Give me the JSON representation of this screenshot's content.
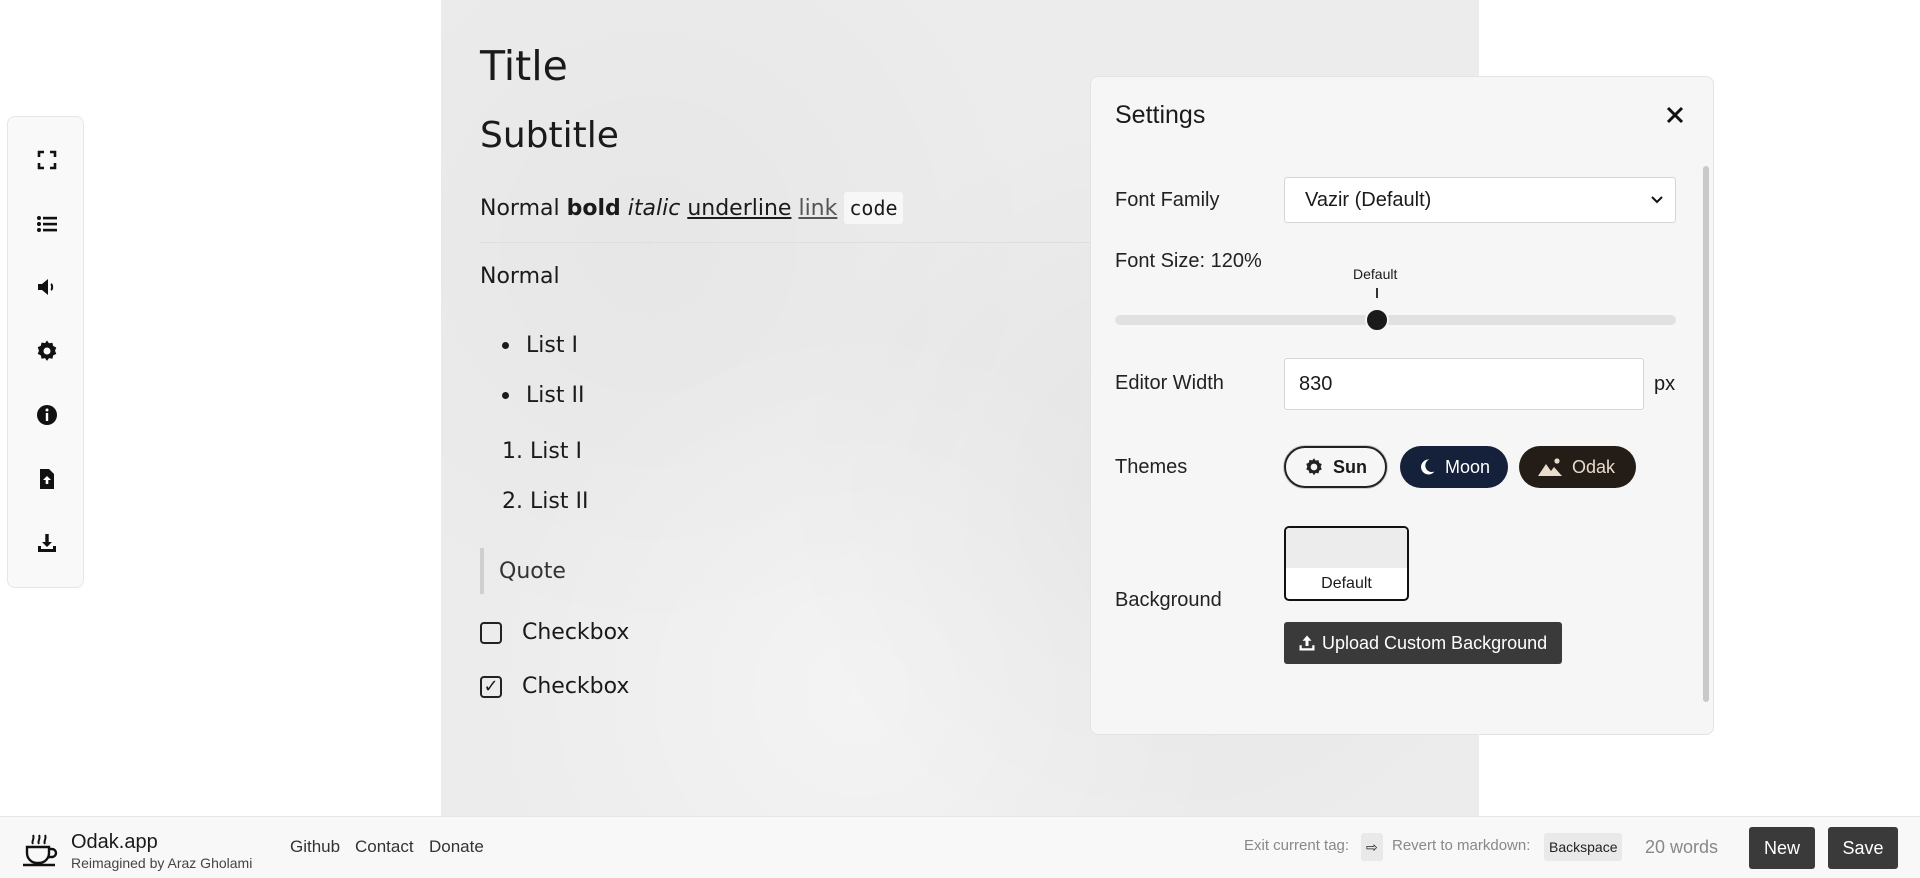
{
  "editor": {
    "title": "Title",
    "subtitle": "Subtitle",
    "inline": {
      "normal": "Normal",
      "bold": "bold",
      "italic": "italic",
      "underline": "underline",
      "link": "link",
      "code": "code"
    },
    "paragraph": "Normal",
    "bullet_list": [
      "List I",
      "List II"
    ],
    "ordered_list": [
      {
        "num": "1.",
        "text": "List I"
      },
      {
        "num": "2.",
        "text": "List II"
      }
    ],
    "quote": "Quote",
    "checkboxes": [
      {
        "label": "Checkbox",
        "checked": false
      },
      {
        "label": "Checkbox",
        "checked": true
      }
    ],
    "check_mark": "✓"
  },
  "toolbar": {
    "icons": [
      "fullscreen-icon",
      "list-icon",
      "speaker-icon",
      "gear-icon",
      "info-icon",
      "file-upload-icon",
      "download-icon"
    ]
  },
  "settings": {
    "title": "Settings",
    "font_family_label": "Font Family",
    "font_family_value": "Vazir (Default)",
    "font_size_label": "Font Size: 120%",
    "font_size_percent": 120,
    "slider_default_label": "Default",
    "editor_width_label": "Editor Width",
    "editor_width_value": "830",
    "editor_width_unit": "px",
    "themes_label": "Themes",
    "themes": [
      {
        "name": "Sun",
        "icon": "sun-icon",
        "selected": true
      },
      {
        "name": "Moon",
        "icon": "moon-icon",
        "selected": false
      },
      {
        "name": "Odak",
        "icon": "mountain-icon",
        "selected": false
      }
    ],
    "background_label": "Background",
    "background_option": "Default",
    "upload_label": "Upload Custom Background"
  },
  "footer": {
    "app_name": "Odak.app",
    "tagline": "Reimagined by Araz Gholami",
    "links": [
      "Github",
      "Contact",
      "Donate"
    ],
    "exit_hint": "Exit current tag:",
    "exit_key": "⇨",
    "revert_hint": "Revert to markdown:",
    "revert_key": "Backspace",
    "word_count": "20 words",
    "new_label": "New",
    "save_label": "Save"
  },
  "colors": {
    "moon_theme": "#15213a",
    "odak_theme": "#231c17",
    "button_dark": "#3a3a3a"
  }
}
